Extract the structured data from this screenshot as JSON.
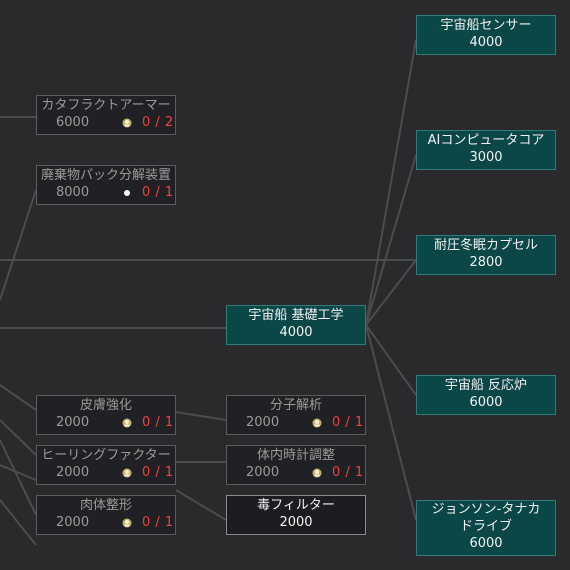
{
  "left_column": [
    {
      "name": "カタフラクトアーマー",
      "cost": "6000",
      "icon": "crew-badge-icon",
      "count": "0 / 2"
    },
    {
      "name": "廃棄物パック分解装置",
      "cost": "8000",
      "icon": "white-dot-icon",
      "count": "0 / 1"
    },
    {
      "name": "皮膚強化",
      "cost": "2000",
      "icon": "crew-badge-icon",
      "count": "0 / 1"
    },
    {
      "name": "ヒーリングファクター",
      "cost": "2000",
      "icon": "crew-badge-icon",
      "count": "0 / 1"
    },
    {
      "name": "肉体整形",
      "cost": "2000",
      "icon": "crew-badge-icon",
      "count": "0 / 1"
    }
  ],
  "middle_column": [
    {
      "name": "宇宙船 基礎工学",
      "cost": "4000",
      "state": "researched"
    },
    {
      "name": "分子解析",
      "cost": "2000",
      "icon": "crew-badge-icon",
      "count": "0 / 1",
      "state": "locked"
    },
    {
      "name": "体内時計調整",
      "cost": "2000",
      "icon": "crew-badge-icon",
      "count": "0 / 1",
      "state": "locked"
    },
    {
      "name": "毒フィルター",
      "cost": "2000",
      "state": "available"
    }
  ],
  "right_column": [
    {
      "name": "宇宙船センサー",
      "cost": "4000"
    },
    {
      "name": "AIコンピュータコア",
      "cost": "3000"
    },
    {
      "name": "耐圧冬眠カプセル",
      "cost": "2800"
    },
    {
      "name": "宇宙船 反応炉",
      "cost": "6000"
    },
    {
      "name": "ジョンソン-タナカ\nドライブ",
      "name_line1": "ジョンソン-タナカ",
      "name_line2": "ドライブ",
      "cost": "6000"
    }
  ],
  "colors": {
    "background": "#2a2a2c",
    "researched_fill": "#0b4747",
    "locked_text": "#9a9a9a",
    "count_red": "#f04040",
    "link_line": "#4a4c4e"
  }
}
